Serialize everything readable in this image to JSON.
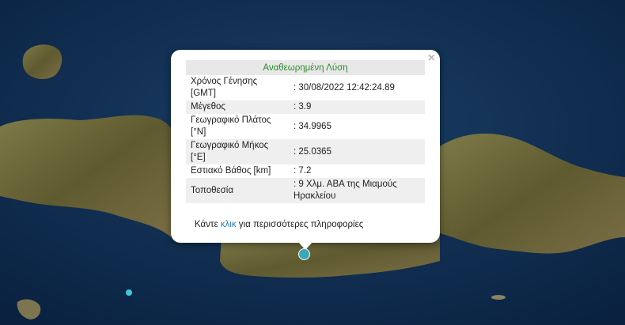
{
  "popup": {
    "title": "Αναθεωρημένη Λύση",
    "close_symbol": "×",
    "rows": [
      {
        "label": "Χρόνος Γένησης [GMT]",
        "value": ": 30/08/2022 12:42:24.89"
      },
      {
        "label": "Μέγεθος",
        "value": ": 3.9"
      },
      {
        "label": "Γεωγραφικό Πλάτος [°N]",
        "value": ": 34.9965"
      },
      {
        "label": "Γεωγραφικό Μήκος [°E]",
        "value": ": 25.0365"
      },
      {
        "label": "Εστιακό Βάθος [km]",
        "value": ": 7.2"
      },
      {
        "label": "Τοποθεσία",
        "value": ": 9 Χλμ. ΑΒΑ της Μιαμούς Ηρακλείου"
      }
    ],
    "more_prefix": "Κάντε ",
    "more_link": "κλικ",
    "more_suffix": " για περισσότερες πληροφορίες"
  },
  "colors": {
    "sea": "#0e2a4a",
    "land": "#6f6a3c",
    "marker": "#3aa7b8",
    "title_green": "#2e8b2e",
    "link": "#2f7fb8"
  },
  "icons": {
    "close": "close-icon",
    "marker": "earthquake-marker"
  }
}
